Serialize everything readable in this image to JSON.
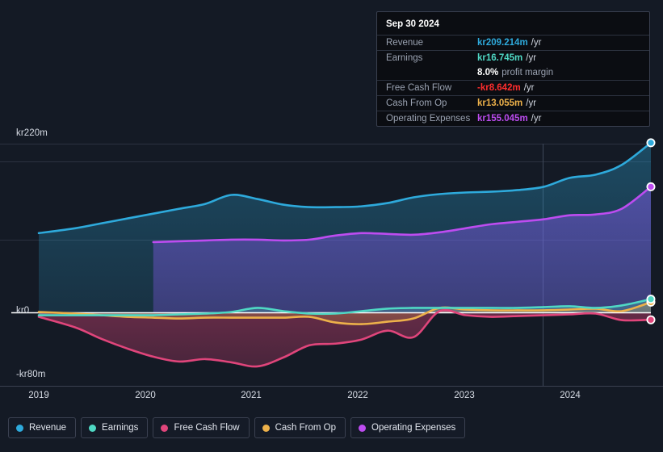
{
  "colors": {
    "revenue": "#2eaadc",
    "earnings": "#4fd8c4",
    "free_cash_flow": "#e0457b",
    "cash_from_op": "#edb14a",
    "operating_expenses": "#bd4cf0",
    "negative_value": "#ff2d2d",
    "background": "#141a25",
    "tooltip_bg": "#0b0d12",
    "zero_line": "#ffffff",
    "grid": "#2b3140"
  },
  "tooltip": {
    "title": "Sep 30 2024",
    "rows": [
      {
        "key": "Revenue",
        "value": "kr209.214m",
        "unit": "/yr",
        "color": "#2eaadc"
      },
      {
        "key": "Earnings",
        "value": "kr16.745m",
        "unit": "/yr",
        "color": "#4fd8c4"
      },
      {
        "key": "",
        "value": "8.0%",
        "sub": "profit margin",
        "color": "#ffffff"
      },
      {
        "key": "Free Cash Flow",
        "value": "-kr8.642m",
        "unit": "/yr",
        "color": "#ff2d2d"
      },
      {
        "key": "Cash From Op",
        "value": "kr13.055m",
        "unit": "/yr",
        "color": "#edb14a"
      },
      {
        "key": "Operating Expenses",
        "value": "kr155.045m",
        "unit": "/yr",
        "color": "#bd4cf0"
      }
    ]
  },
  "axes": {
    "y_top_label": "kr220m",
    "y_zero_label": "kr0",
    "y_bottom_label": "-kr80m",
    "y_max": 220,
    "y_min": -80,
    "x_ticks": [
      "2019",
      "2020",
      "2021",
      "2022",
      "2023",
      "2024"
    ],
    "x_tick_positions": [
      48,
      180,
      311,
      443,
      575,
      706
    ]
  },
  "legend": [
    {
      "label": "Revenue",
      "color": "#2eaadc"
    },
    {
      "label": "Earnings",
      "color": "#4fd8c4"
    },
    {
      "label": "Free Cash Flow",
      "color": "#e0457b"
    },
    {
      "label": "Cash From Op",
      "color": "#edb14a"
    },
    {
      "label": "Operating Expenses",
      "color": "#bd4cf0"
    }
  ],
  "chart_data": {
    "type": "area",
    "title": "",
    "xlabel": "",
    "ylabel": "",
    "currency": "kr",
    "unit": "m",
    "period": "/yr",
    "ylim": [
      -80,
      220
    ],
    "xlim": [
      2018.9,
      2024.78
    ],
    "grid": true,
    "legend_position": "bottom",
    "gridlines_y": [
      220,
      205,
      140
    ],
    "zero_line": 0,
    "forecast_divider_x": 2023.75,
    "x": [
      2018.9,
      2019.25,
      2019.5,
      2019.75,
      2020.0,
      2020.25,
      2020.5,
      2020.75,
      2021.0,
      2021.25,
      2021.5,
      2021.75,
      2022.0,
      2022.25,
      2022.5,
      2022.75,
      2023.0,
      2023.25,
      2023.5,
      2023.75,
      2024.0,
      2024.25,
      2024.5,
      2024.78
    ],
    "series": [
      {
        "name": "Revenue",
        "color": "#2eaadc",
        "values": [
          98,
          104,
          110,
          116,
          122,
          128,
          134,
          145,
          140,
          133,
          130,
          130,
          131,
          135,
          142,
          146,
          148,
          149,
          151,
          155,
          166,
          170,
          182,
          209.214
        ],
        "last_value": 209.214,
        "last_label": "kr209.214m"
      },
      {
        "name": "Operating Expenses",
        "color": "#bd4cf0",
        "values": [
          null,
          null,
          null,
          null,
          87,
          88,
          89,
          90,
          90,
          89,
          90,
          95,
          98,
          97,
          96,
          99,
          104,
          109,
          112,
          115,
          120,
          121,
          128,
          155.045
        ],
        "last_value": 155.045,
        "last_label": "kr155.045m"
      },
      {
        "name": "Earnings",
        "color": "#4fd8c4",
        "values": [
          -3,
          -3,
          -3,
          -3,
          -3,
          -2,
          -1,
          1,
          6,
          2,
          -1,
          -1,
          2,
          5,
          6,
          6,
          6,
          6,
          6,
          7,
          8,
          6,
          9,
          16.745
        ],
        "last_value": 16.745,
        "last_label": "kr16.745m"
      },
      {
        "name": "Cash From Op",
        "color": "#edb14a",
        "values": [
          1,
          -1,
          -3,
          -5,
          -6,
          -7,
          -6,
          -6,
          -6,
          -6,
          -5,
          -12,
          -14,
          -11,
          -7,
          6,
          4,
          3,
          3,
          3,
          4,
          5,
          2,
          13.055
        ],
        "last_value": 13.055,
        "last_label": "kr13.055m"
      },
      {
        "name": "Free Cash Flow",
        "color": "#e0457b",
        "values": [
          -5,
          -18,
          -32,
          -44,
          -54,
          -60,
          -57,
          -61,
          -66,
          -55,
          -40,
          -38,
          -33,
          -22,
          -30,
          2,
          -3,
          -5,
          -4,
          -3,
          -2,
          -1,
          -9,
          -8.642
        ],
        "last_value": -8.642,
        "last_label": "-kr8.642m"
      }
    ],
    "profit_margin": "8.0%",
    "as_of": "Sep 30 2024"
  }
}
